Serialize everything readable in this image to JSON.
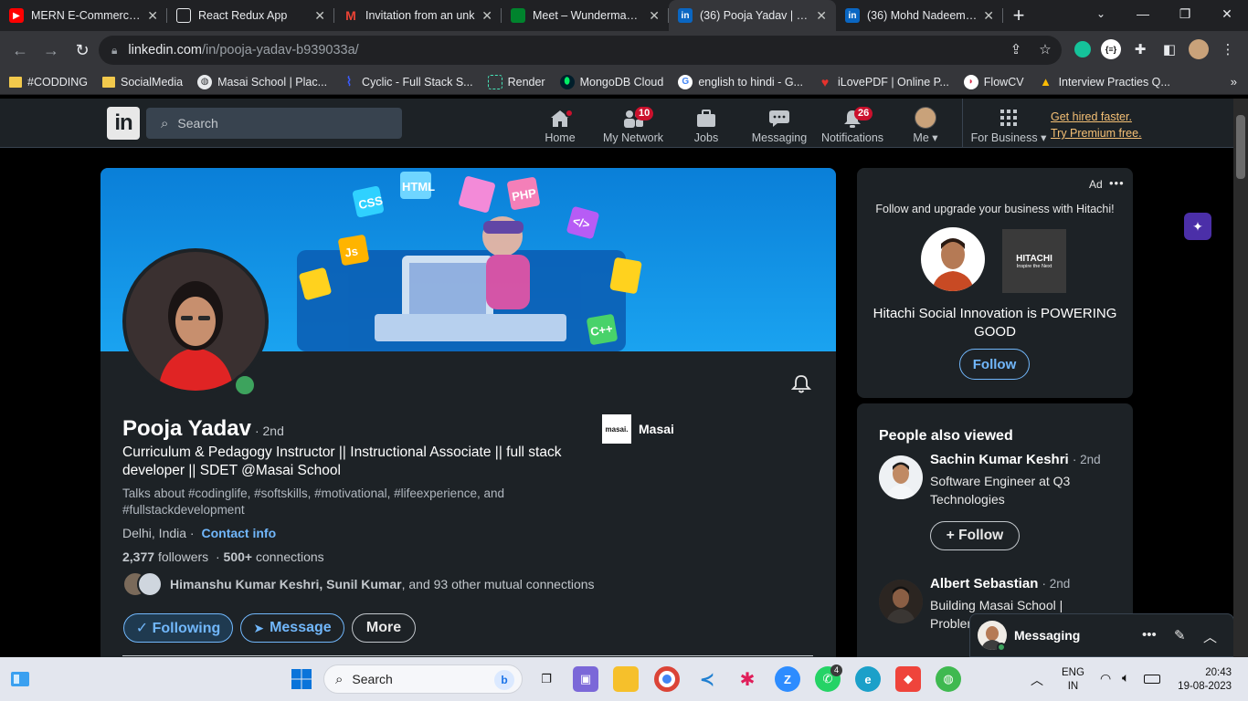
{
  "browser": {
    "tabs": [
      {
        "title": "MERN E-Commerce - ",
        "icon": "youtube-icon",
        "color": "#ff0000"
      },
      {
        "title": "React Redux App",
        "icon": "codesandbox-icon",
        "color": "#ffffff"
      },
      {
        "title": "Invitation from an unk",
        "icon": "gmail-icon",
        "color": "#ea4335"
      },
      {
        "title": "Meet – Wunderman Th",
        "icon": "google-meet-icon",
        "color": "#00832d"
      },
      {
        "title": "(36) Pooja Yadav | Link",
        "icon": "linkedin-icon",
        "color": "#0a66c2",
        "active": true
      },
      {
        "title": "(36) Mohd Nadeem | L",
        "icon": "linkedin-icon",
        "color": "#0a66c2"
      }
    ],
    "url_host": "linkedin.com",
    "url_path": "/in/pooja-yadav-b939033a/",
    "bookmarks": [
      {
        "label": "#CODDING",
        "icon": "folder-icon"
      },
      {
        "label": "SocialMedia",
        "icon": "folder-icon"
      },
      {
        "label": "Masai School | Plac...",
        "icon": "globe-icon"
      },
      {
        "label": "Cyclic - Full Stack S...",
        "icon": "cyclic-icon"
      },
      {
        "label": "Render",
        "icon": "render-icon"
      },
      {
        "label": "MongoDB Cloud",
        "icon": "mongodb-icon"
      },
      {
        "label": "english to hindi - G...",
        "icon": "google-icon"
      },
      {
        "label": "iLovePDF | Online P...",
        "icon": "ilovepdf-icon"
      },
      {
        "label": "FlowCV",
        "icon": "flowcv-icon"
      },
      {
        "label": "Interview Practies Q...",
        "icon": "google-drive-icon"
      }
    ]
  },
  "linkedin": {
    "search_placeholder": "Search",
    "nav": [
      {
        "label": "Home",
        "icon": "home-icon",
        "dot": true
      },
      {
        "label": "My Network",
        "icon": "network-icon",
        "badge": "10"
      },
      {
        "label": "Jobs",
        "icon": "briefcase-icon"
      },
      {
        "label": "Messaging",
        "icon": "chat-icon"
      },
      {
        "label": "Notifications",
        "icon": "bell-icon",
        "badge": "26"
      },
      {
        "label": "Me",
        "icon": "avatar-icon"
      },
      {
        "label": "For Business",
        "icon": "grid-icon"
      }
    ],
    "premium": {
      "line1": "Get hired faster.",
      "line2": "Try Premium free."
    },
    "profile": {
      "name": "Pooja Yadav",
      "degree": "· 2nd",
      "headline": "Curriculum & Pedagogy Instructor || Instructional Associate || full stack developer || SDET @Masai School",
      "talks_about": "Talks about #codinglife, #softskills, #motivational, #lifeexperience, and #fullstackdevelopment",
      "location": "Delhi, India ·",
      "contact_info": "Contact info",
      "followers_count": "2,377",
      "followers_label": "followers",
      "connections_count": "500+",
      "connections_label": "connections",
      "mutual_names": "Himanshu Kumar Keshri, Sunil Kumar",
      "mutual_rest": ", and 93 other mutual connections",
      "company": "Masai",
      "company_logo_text": "masai.",
      "buttons": {
        "following": "✓ Following",
        "message": "Message",
        "more": "More"
      }
    },
    "ad": {
      "label": "Ad",
      "text": "Follow and upgrade your business with Hitachi!",
      "brand": "HITACHI",
      "brand_tagline": "Inspire the Next",
      "headline": "Hitachi Social Innovation is POWERING GOOD",
      "follow": "Follow"
    },
    "people_also_viewed": {
      "title": "People also viewed",
      "people": [
        {
          "name": "Sachin Kumar Keshri",
          "degree": "· 2nd",
          "headline": "Software Engineer at Q3 Technologies",
          "follow": "+ Follow"
        },
        {
          "name": "Albert Sebastian",
          "degree": "· 2nd",
          "headline": "Building Masai School | Problem"
        }
      ]
    },
    "messaging": {
      "label": "Messaging"
    }
  },
  "taskbar": {
    "search_placeholder": "Search",
    "lang_line1": "ENG",
    "lang_line2": "IN",
    "time": "20:43",
    "date": "19-08-2023",
    "whatsapp_badge": "4"
  }
}
